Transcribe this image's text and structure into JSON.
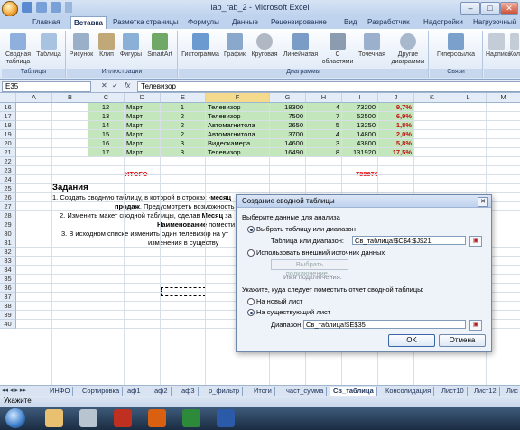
{
  "window": {
    "title": "lab_rab_2 - Microsoft Excel",
    "minimize": "–",
    "maximize": "□",
    "close": "✕"
  },
  "ribbon_tabs": [
    "Главная",
    "Вставка",
    "Разметка страницы",
    "Формулы",
    "Данные",
    "Рецензирование",
    "Вид",
    "Разработчик",
    "Надстройки",
    "Нагрузочный"
  ],
  "ribbon_groups": {
    "tables": {
      "label": "Таблицы",
      "buttons": [
        "Сводная таблица",
        "Таблица"
      ]
    },
    "illustrations": {
      "label": "Иллюстрации",
      "buttons": [
        "Рисунок",
        "Клип",
        "Фигуры",
        "SmartArt"
      ]
    },
    "charts": {
      "label": "Диаграммы",
      "buttons": [
        "Гистограмма",
        "График",
        "Круговая",
        "Линейчатая",
        "С областями",
        "Точечная",
        "Другие диаграммы"
      ]
    },
    "links": {
      "label": "Связи",
      "buttons": [
        "Гиперссылка"
      ]
    },
    "text": {
      "label": "",
      "buttons": [
        "Надпись",
        "Кол"
      ]
    }
  },
  "formula_bar": {
    "name_box": "E35",
    "fx": "fx",
    "formula": "Телевизор"
  },
  "columns": [
    "A",
    "B",
    "C",
    "D",
    "E",
    "F",
    "G",
    "H",
    "I",
    "J",
    "K",
    "L",
    "M"
  ],
  "rows": [
    "16",
    "17",
    "18",
    "19",
    "20",
    "21",
    "22",
    "23",
    "24",
    "25",
    "26",
    "27",
    "28",
    "29",
    "30",
    "31",
    "32",
    "33",
    "34",
    "35",
    "36",
    "37",
    "38",
    "39",
    "40"
  ],
  "table_rows": [
    {
      "c": "12",
      "d": "Март",
      "e": "1",
      "f": "Телевизор",
      "g": "18300",
      "h": "4",
      "i": "73200",
      "j": "9,7%"
    },
    {
      "c": "13",
      "d": "Март",
      "e": "2",
      "f": "Телевизор",
      "g": "7500",
      "h": "7",
      "i": "52500",
      "j": "6,9%"
    },
    {
      "c": "14",
      "d": "Март",
      "e": "2",
      "f": "Автомагнитола",
      "g": "2650",
      "h": "5",
      "i": "13250",
      "j": "1,8%"
    },
    {
      "c": "15",
      "d": "Март",
      "e": "2",
      "f": "Автомагнитола",
      "g": "3700",
      "h": "4",
      "i": "14800",
      "j": "2,0%"
    },
    {
      "c": "16",
      "d": "Март",
      "e": "3",
      "f": "Видеокамера",
      "g": "14600",
      "h": "3",
      "i": "43800",
      "j": "5,8%"
    },
    {
      "c": "17",
      "d": "Март",
      "e": "3",
      "f": "Телевизор",
      "g": "16490",
      "h": "8",
      "i": "131920",
      "j": "17,5%"
    }
  ],
  "totals": {
    "label": "ИТОГО",
    "value": "755970"
  },
  "tasks": {
    "heading": "Задания",
    "line1a": "1. Создать сводную таблицу, в  которой в строках -",
    "line1b": "месяц",
    "line2a": "продаж",
    "line2b": ". Предусмотреть возможность",
    "line3a": "2. Изменить макет сводной таблицы, сделав ",
    "line3b": "Месяц",
    "line3c": " за",
    "line4a": "Наименование",
    "line4b": " помести",
    "line5": "3. В исходном списке изменить один телевизор на ут",
    "line6": "изменения в существу"
  },
  "dialog": {
    "title": "Создание сводной таблицы",
    "close": "✕",
    "section1": "Выберите данные для анализа",
    "opt_table": "Выбрать таблицу или диапазон",
    "range_label": "Таблица или диапазон:",
    "range_value": "Св_таблица!$C$4:$J$21",
    "opt_external": "Использовать внешний источник данных",
    "choose_conn": "Выбрать подключение...",
    "conn_name": "Имя подключения:",
    "section2": "Укажите, куда следует поместить отчет сводной таблицы:",
    "opt_new": "На новый лист",
    "opt_existing": "На существующий лист",
    "loc_label": "Диапазон:",
    "loc_value": "Св_таблица!$E$35",
    "ok": "OK",
    "cancel": "Отмена"
  },
  "sheet_tabs": [
    "ИНФО",
    "Сортировка",
    "аф1",
    "аф2",
    "аф3",
    "р_фильтр",
    "Итоги",
    "част_сумма",
    "Св_таблица",
    "Консолидация",
    "Лист10",
    "Лист12",
    "Лис"
  ],
  "active_sheet": "Св_таблица",
  "status": "Укажите",
  "colors": {
    "green_fill": "#c3e6bd",
    "red_text": "#e01010",
    "ribbon_blue": "#bfd3ee"
  }
}
